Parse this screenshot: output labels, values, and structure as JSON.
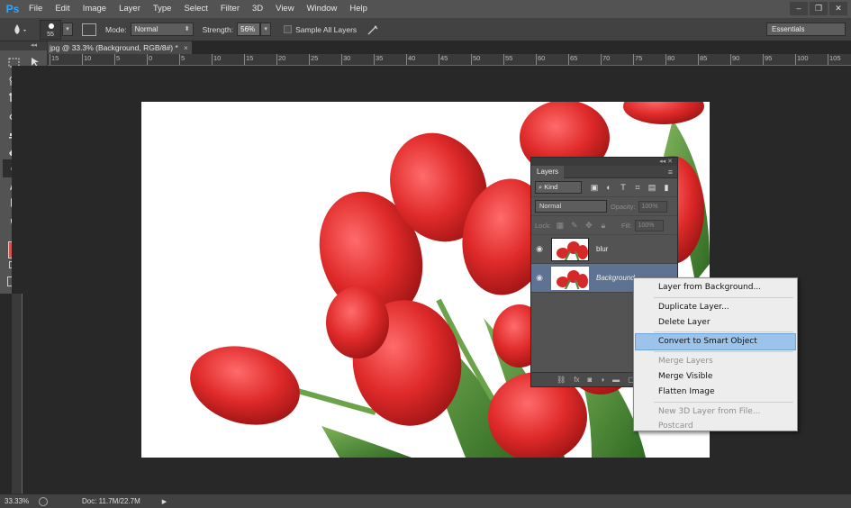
{
  "app": {
    "logo": "Ps",
    "menu": [
      "File",
      "Edit",
      "Image",
      "Layer",
      "Type",
      "Select",
      "Filter",
      "3D",
      "View",
      "Window",
      "Help"
    ],
    "window_controls": [
      "–",
      "❐",
      "✕"
    ]
  },
  "options_bar": {
    "brush_size": "55",
    "mode_label": "Mode:",
    "mode_value": "Normal",
    "strength_label": "Strength:",
    "strength_value": "56%",
    "sample_all_layers_label": "Sample All Layers",
    "workspace": "Essentials"
  },
  "document": {
    "tab_title": "jpg @ 33.3% (Background, RGB/8#) *",
    "tab_close": "×"
  },
  "ruler": {
    "ticks": [
      "15",
      "10",
      "5",
      "0",
      "5",
      "10",
      "15",
      "20",
      "25",
      "30",
      "35",
      "40",
      "45",
      "50",
      "55",
      "60",
      "65",
      "70",
      "75",
      "80",
      "85",
      "90",
      "95",
      "100",
      "105"
    ]
  },
  "toolbox": {
    "collapse": "◂◂",
    "tools": [
      "rectangular-marquee-icon",
      "move-icon",
      "lasso-icon",
      "quick-selection-icon",
      "crop-icon",
      "eyedropper-icon",
      "spot-healing-icon",
      "brush-icon",
      "clone-stamp-icon",
      "history-brush-icon",
      "eraser-icon",
      "paint-bucket-icon",
      "blur-icon",
      "dodge-icon",
      "pen-icon",
      "type-icon",
      "path-selection-icon",
      "ellipse-icon",
      "hand-icon",
      "zoom-icon"
    ],
    "foreground_color": "#d45454",
    "background_color": "#ffffff"
  },
  "layers_panel": {
    "title": "Layers",
    "panel_collapse": "◂◂ ✕",
    "kind_label": "Kind",
    "blend_mode": "Normal",
    "opacity_label": "Opacity:",
    "opacity_value": "100%",
    "lock_label": "Lock:",
    "fill_label": "Fill:",
    "fill_value": "100%",
    "layers": [
      {
        "name": "blur",
        "visible": true,
        "selected": false
      },
      {
        "name": "Background",
        "visible": true,
        "selected": true
      }
    ]
  },
  "context_menu": {
    "items": [
      {
        "label": "Layer from Background...",
        "enabled": true
      },
      {
        "label": "Duplicate Layer...",
        "enabled": true
      },
      {
        "label": "Delete Layer",
        "enabled": true
      },
      {
        "label": "Convert to Smart Object",
        "enabled": true,
        "highlighted": true
      },
      {
        "label": "Merge Layers",
        "enabled": false
      },
      {
        "label": "Merge Visible",
        "enabled": true
      },
      {
        "label": "Flatten Image",
        "enabled": true
      },
      {
        "label": "New 3D Layer from File...",
        "enabled": false
      },
      {
        "label": "Postcard",
        "enabled": false
      }
    ]
  },
  "status_bar": {
    "zoom": "33.33%",
    "doc_size": "Doc: 11.7M/22.7M",
    "arrow": "▶"
  },
  "colors": {
    "accent_highlight": "#9bc3eb",
    "selected_layer": "#5e7393",
    "tulip_red": "#d62828",
    "stem_green": "#4f8a3a"
  }
}
